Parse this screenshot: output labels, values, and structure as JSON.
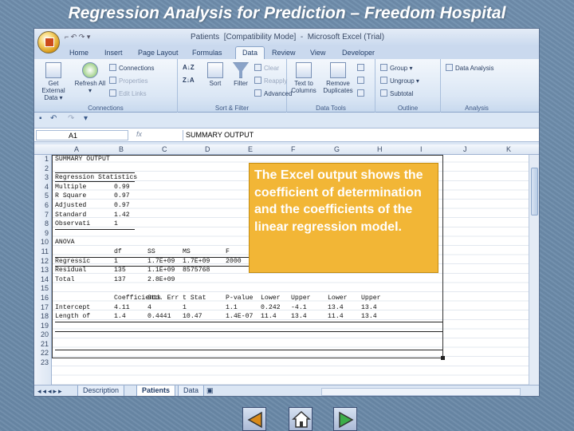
{
  "slide": {
    "title": "Regression Analysis for Prediction – Freedom Hospital"
  },
  "window": {
    "title": "Patients  [Compatibility Mode]  -  Microsoft Excel (Trial)",
    "qat_glyphs": "⌐ ↶ ↷ ▾"
  },
  "ribbon": {
    "tabs": [
      "Home",
      "Insert",
      "Page Layout",
      "Formulas",
      "Data",
      "Review",
      "View",
      "Developer"
    ],
    "active_tab": "Data",
    "groups": {
      "connections": {
        "label": "Connections",
        "get_external_data": "Get External Data ▾",
        "refresh_all": "Refresh All ▾",
        "items": [
          "Connections",
          "Properties",
          "Edit Links"
        ]
      },
      "sort_filter": {
        "label": "Sort & Filter",
        "sort_az": "A↓Z",
        "sort_za": "Z↓A",
        "sort": "Sort",
        "filter": "Filter",
        "items": [
          "Clear",
          "Reapply",
          "Advanced"
        ]
      },
      "data_tools": {
        "label": "Data Tools",
        "text_to_columns": "Text to Columns",
        "remove_duplicates": "Remove Duplicates"
      },
      "outline": {
        "label": "Outline",
        "items": [
          "Group ▾",
          "Ungroup ▾",
          "Subtotal"
        ]
      },
      "analysis": {
        "label": "Analysis",
        "data_analysis": "Data Analysis"
      }
    }
  },
  "formula_bar": {
    "name_box": "A1",
    "fx": "fx",
    "value": "SUMMARY OUTPUT"
  },
  "columns": [
    "A",
    "B",
    "C",
    "D",
    "E",
    "F",
    "G",
    "H",
    "I",
    "J",
    "K"
  ],
  "rows": [
    "1",
    "2",
    "3",
    "4",
    "5",
    "6",
    "7",
    "8",
    "9",
    "10",
    "11",
    "12",
    "13",
    "14",
    "15",
    "16",
    "17",
    "18",
    "19",
    "20",
    "21",
    "22",
    "23"
  ],
  "sheet_cells": [
    [
      "SUMMARY OUTPUT"
    ],
    [
      ""
    ],
    [
      "Regression Statistics"
    ],
    [
      "Multiple ",
      "0.99"
    ],
    [
      "R Square ",
      "0.97"
    ],
    [
      "Adjusted ",
      "0.97"
    ],
    [
      "Standard ",
      "1.42"
    ],
    [
      "Observati",
      "1"
    ],
    [
      ""
    ],
    [
      "ANOVA"
    ],
    [
      "",
      "df",
      "SS",
      "MS",
      "F"
    ],
    [
      "Regressic",
      "1",
      "1.7E+09",
      "1.7E+09",
      "2000"
    ],
    [
      "Residual",
      "135",
      "1.1E+09",
      "8575768"
    ],
    [
      "Total",
      "137",
      "2.8E+09"
    ],
    [
      ""
    ],
    [
      "",
      "Coefficients",
      "Std. Err",
      "t Stat",
      "P-value",
      "Lower",
      "Upper",
      "Lower",
      "Upper"
    ],
    [
      "Intercept",
      "4.11",
      "4",
      "1",
      "1.1",
      "0.242",
      "-4.1",
      "13.4",
      "13.4"
    ],
    [
      "Length of",
      "1.4",
      "0.4441",
      "10.47",
      "1.4E-07",
      "11.4",
      "13.4",
      "11.4",
      "13.4"
    ]
  ],
  "sheets": [
    "Description",
    "Patients",
    "Data"
  ],
  "active_sheet": "Patients",
  "callout": {
    "text": "The Excel output shows the coefficient of determination and the coefficients of the linear regression model."
  },
  "colors": {
    "callout": "#f2b636",
    "slide_bg": "#6f8ead",
    "title": "#ffffff"
  },
  "nav": {
    "icons": [
      "back-icon",
      "home-icon",
      "forward-icon"
    ]
  }
}
